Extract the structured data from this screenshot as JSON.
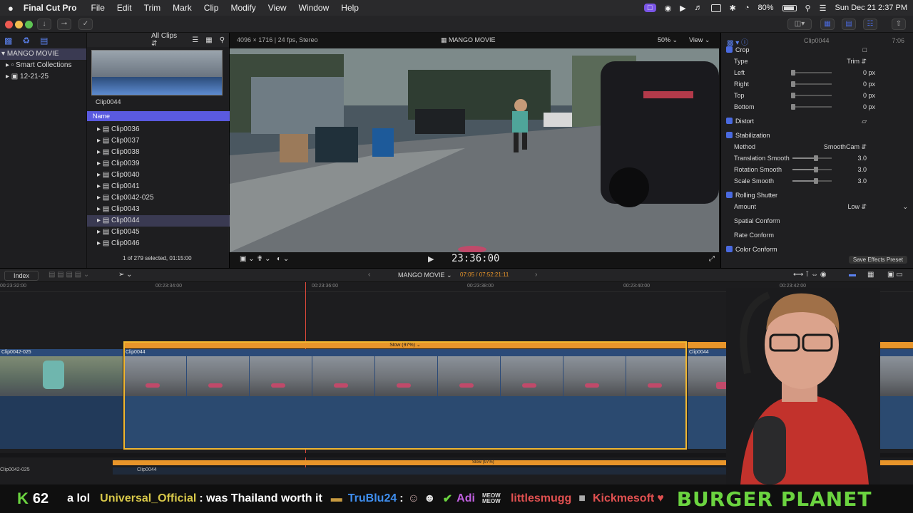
{
  "menubar": {
    "app": "Final Cut Pro",
    "items": [
      "File",
      "Edit",
      "Trim",
      "Mark",
      "Clip",
      "Modify",
      "View",
      "Window",
      "Help"
    ],
    "battery": "80%",
    "datetime": "Sun Dec 21  2:37 PM"
  },
  "library": {
    "root": "MANGO MOVIE",
    "items": [
      "Smart Collections",
      "12-21-25"
    ]
  },
  "browser": {
    "filter": "All Clips",
    "thumb_label": "Clip0044",
    "column": "Name",
    "clips": [
      "Clip0036",
      "Clip0037",
      "Clip0038",
      "Clip0039",
      "Clip0040",
      "Clip0041",
      "Clip0042-025",
      "Clip0043",
      "Clip0044",
      "Clip0045",
      "Clip0046"
    ],
    "selected": "Clip0044",
    "status": "1 of 279 selected, 01:15:00"
  },
  "viewer": {
    "format": "4096 × 1716 | 24 fps, Stereo",
    "title": "MANGO MOVIE",
    "zoom": "50%",
    "view": "View",
    "timecode": "23:36:00"
  },
  "inspector": {
    "clip": "Clip0044",
    "duration": "7:06",
    "crop": {
      "section": "Crop",
      "type_label": "Type",
      "type_value": "Trim",
      "fields": [
        {
          "label": "Left",
          "value": "0"
        },
        {
          "label": "Right",
          "value": "0"
        },
        {
          "label": "Top",
          "value": "0"
        },
        {
          "label": "Bottom",
          "value": "0"
        }
      ],
      "unit": "px"
    },
    "distort": "Distort",
    "stabilization": {
      "section": "Stabilization",
      "method_label": "Method",
      "method_value": "SmoothCam",
      "rows": [
        {
          "label": "Translation Smooth",
          "value": "3.0"
        },
        {
          "label": "Rotation Smooth",
          "value": "3.0"
        },
        {
          "label": "Scale Smooth",
          "value": "3.0"
        }
      ]
    },
    "rolling": {
      "section": "Rolling Shutter",
      "amount_label": "Amount",
      "amount_value": "Low"
    },
    "spatial": "Spatial Conform",
    "rate": "Rate Conform",
    "color": "Color Conform",
    "save_preset": "Save Effects Preset"
  },
  "timeline": {
    "index": "Index",
    "project": "MANGO MOVIE",
    "position": "07:05 / 07:52:21:11",
    "ruler": [
      "00:23:32:00",
      "00:23:34:00",
      "00:23:36:00",
      "00:23:38:00",
      "00:23:40:00",
      "00:23:42:00"
    ],
    "clips": {
      "prev": "Clip0042-025",
      "main": "Clip0044",
      "next": "Clip0044",
      "retime": "Slow (97%)",
      "retime_next": "Slow (58"
    },
    "mini": {
      "prev": "Clip0042-025",
      "main": "Clip0044",
      "retime": "Slow (97%)"
    }
  },
  "ticker": {
    "count": "62",
    "m1": "a lol",
    "user2": "Universal_Official",
    "m2": ": was Thailand worth it",
    "user3": "TruBlu24",
    "colon": ":",
    "user4": "Adi",
    "meow": "MEOW MEOW",
    "user5": "littlesmugg",
    "user6": "Kickmesoft",
    "sponsor": "BURGER PLANET"
  },
  "colors": {
    "accent": "#4a6ae0",
    "clip_selected": "#f1b731",
    "retime": "#e8952a",
    "playhead": "#e0493a",
    "ticker_green": "#6bd440"
  }
}
